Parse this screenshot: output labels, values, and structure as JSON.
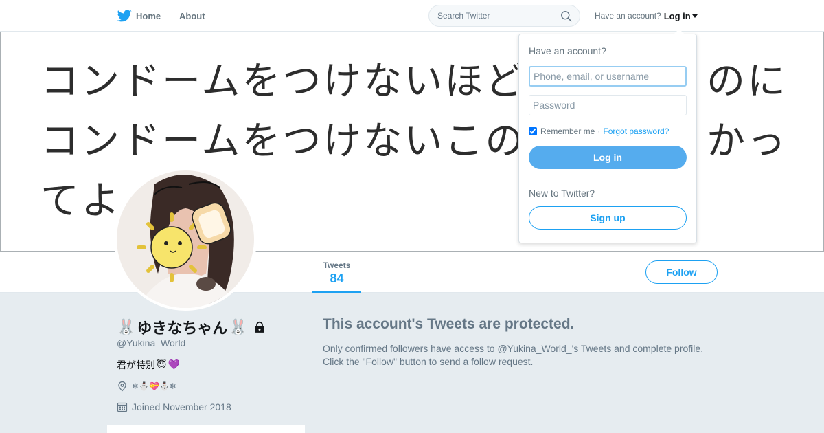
{
  "nav": {
    "home_label": "Home",
    "about_label": "About",
    "search_placeholder": "Search Twitter",
    "have_account": "Have an account?",
    "login_label": "Log in"
  },
  "banner": {
    "lines": [
      "コンドームをつけないほど好",
      "コンドームをつけないこの気",
      "てよ"
    ],
    "right_fragments": [
      "のに",
      "かっ"
    ]
  },
  "profile": {
    "name_text": "ゆきなちゃん",
    "name_emoji_left": "🐰",
    "name_emoji_right": "🐰",
    "handle": "@Yukina_World_",
    "bio_text": "君が特別",
    "bio_emoji": [
      "😇",
      "💜"
    ],
    "location_text": "❄⛄💝⛄❄",
    "joined": "Joined November 2018"
  },
  "stats": {
    "tweets_label": "Tweets",
    "tweets_value": "84"
  },
  "follow_label": "Follow",
  "protected": {
    "title": "This account's Tweets are protected.",
    "text": "Only confirmed followers have access to @Yukina_World_'s Tweets and complete profile. Click the \"Follow\" button to send a follow request."
  },
  "login_dropdown": {
    "heading": "Have an account?",
    "username_placeholder": "Phone, email, or username",
    "password_placeholder": "Password",
    "remember_label": "Remember me",
    "separator": "·",
    "forgot_label": "Forgot password?",
    "login_button": "Log in",
    "new_heading": "New to Twitter?",
    "signup_button": "Sign up"
  },
  "colors": {
    "accent": "#1da1f2",
    "login_button_bg": "#55acee",
    "page_bg": "#e6ecf0"
  },
  "icons": [
    "twitter-bird-icon",
    "search-icon",
    "lock-icon",
    "location-icon",
    "calendar-icon"
  ]
}
